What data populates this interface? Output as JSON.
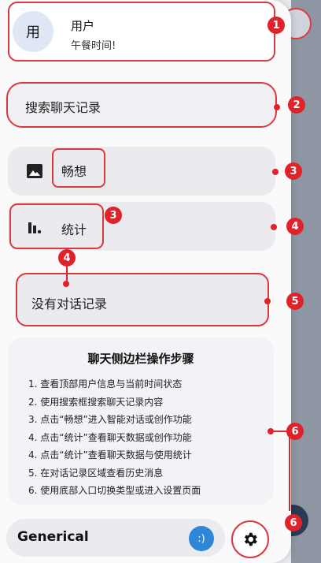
{
  "user": {
    "avatar_text": "用",
    "name": "用户",
    "subtitle": "午餐时间!"
  },
  "search": {
    "label": "搜索聊天记录"
  },
  "nav": [
    {
      "label": "畅想",
      "icon": "image-icon"
    },
    {
      "label": "统计",
      "icon": "bar-chart-icon"
    }
  ],
  "empty_state": {
    "label": "没有对话记录"
  },
  "steps": {
    "title": "聊天侧边栏操作步骤",
    "items": [
      "1. 查看顶部用户信息与当前时间状态",
      "2. 使用搜索框搜索聊天记录内容",
      "3. 点击“畅想”进入智能对话或创作功能",
      "4. 点击“统计”查看聊天数据或创作功能",
      "4. 点击“统计”查看聊天数据与使用统计",
      "5. 在对话记录区域查看历史消息",
      "6. 使用底部入口切换类型或进入设置页面"
    ]
  },
  "bottom": {
    "label": "Generical",
    "button_glyph": ":)"
  },
  "badges": [
    "1",
    "2",
    "3",
    "3",
    "4",
    "4",
    "5",
    "6",
    "6"
  ],
  "colors": {
    "annotation": "#e0232a",
    "accent_blue": "#2f86d6"
  }
}
